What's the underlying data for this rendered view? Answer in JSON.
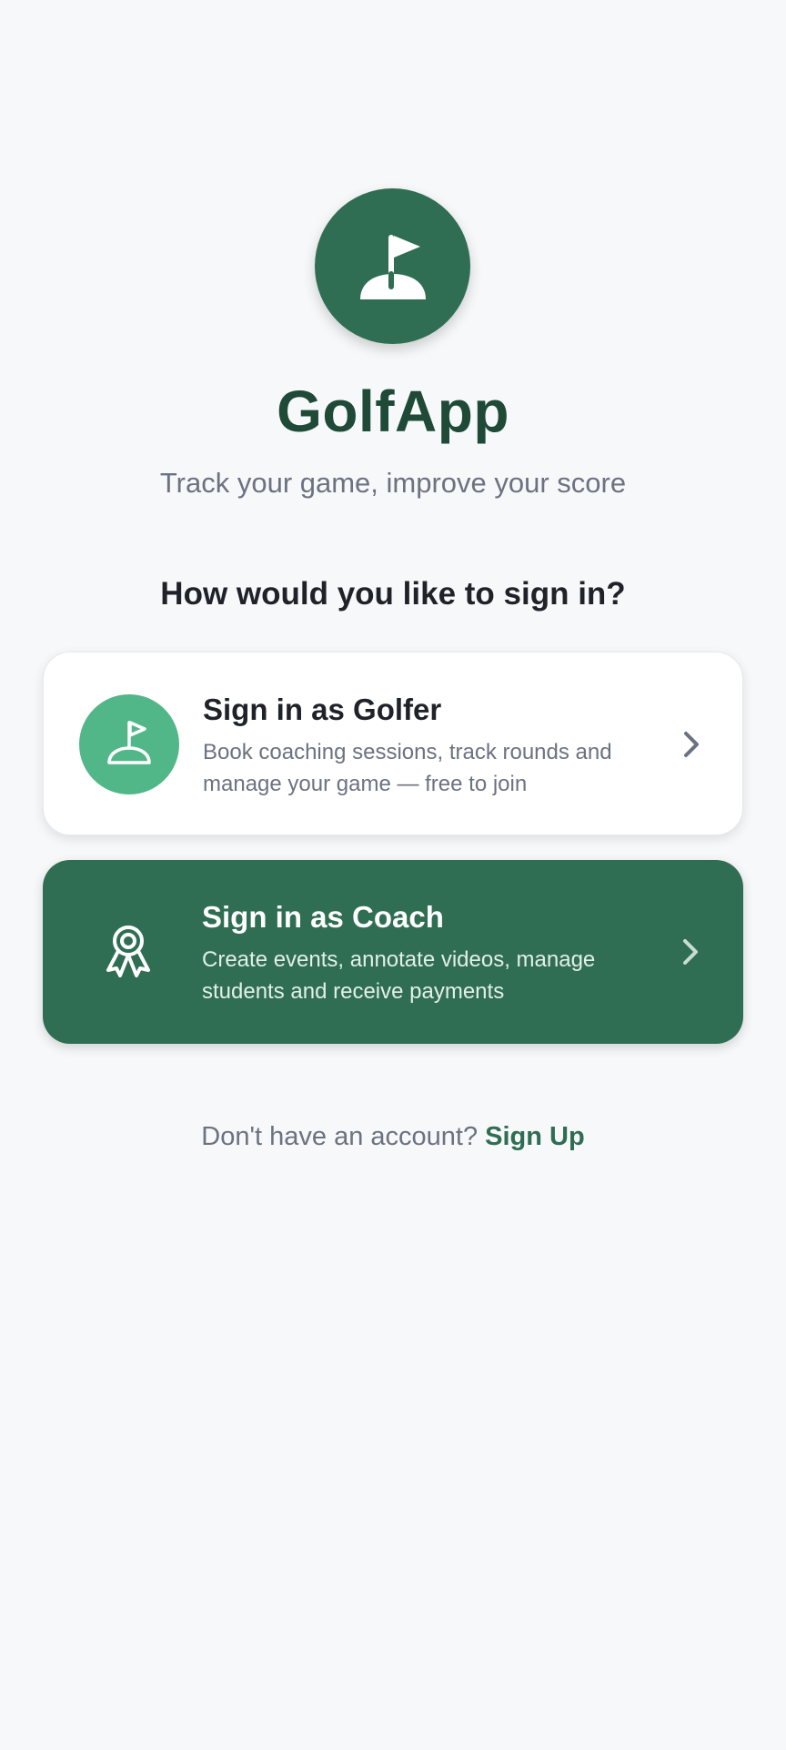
{
  "app": {
    "title": "GolfApp",
    "tagline": "Track your game, improve your score",
    "logo_icon": "golf-flag-icon"
  },
  "sign_in": {
    "prompt": "How would you like to sign in?",
    "options": [
      {
        "title": "Sign in as Golfer",
        "description": "Book coaching sessions, track rounds and manage your game — free to join",
        "icon": "golf-flag-icon"
      },
      {
        "title": "Sign in as Coach",
        "description": "Create events, annotate videos, manage students and receive payments",
        "icon": "award-ribbon-icon"
      }
    ]
  },
  "footer": {
    "prompt_text": "Don't have an account?",
    "signup_label": "Sign Up"
  },
  "colors": {
    "brand_green": "#2f6e52",
    "light_green": "#52b788",
    "title_green": "#1e4a37",
    "background": "#f7f8fa"
  }
}
